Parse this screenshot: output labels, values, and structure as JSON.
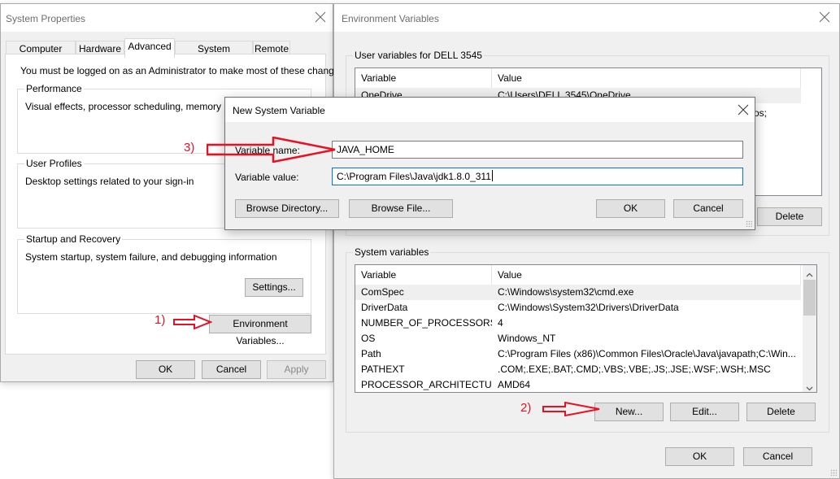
{
  "system_properties": {
    "title": "System Properties",
    "tabs": [
      {
        "label": "Computer Name",
        "active": false
      },
      {
        "label": "Hardware",
        "active": false
      },
      {
        "label": "Advanced",
        "active": true
      },
      {
        "label": "System Protection",
        "active": false
      },
      {
        "label": "Remote",
        "active": false
      }
    ],
    "admin_note": "You must be logged on as an Administrator to make most of these changes.",
    "performance": {
      "legend": "Performance",
      "desc": "Visual effects, processor scheduling, memory usage,"
    },
    "user_profiles": {
      "legend": "User Profiles",
      "desc": "Desktop settings related to your sign-in"
    },
    "startup": {
      "legend": "Startup and Recovery",
      "desc": "System startup, system failure, and debugging information",
      "settings_label": "Settings..."
    },
    "env_vars_label": "Environment Variables...",
    "ok_label": "OK",
    "cancel_label": "Cancel",
    "apply_label": "Apply"
  },
  "environment_variables": {
    "title": "Environment Variables",
    "user_section": {
      "legend": "User variables for DELL 3545",
      "columns": [
        "Variable",
        "Value"
      ],
      "rows": [
        {
          "variable": "OneDrive",
          "value": "C:\\Users\\DELL 3545\\OneDrive"
        }
      ],
      "partial_text": "os;",
      "delete_label": "Delete"
    },
    "system_section": {
      "legend": "System variables",
      "columns": [
        "Variable",
        "Value"
      ],
      "rows": [
        {
          "variable": "ComSpec",
          "value": "C:\\Windows\\system32\\cmd.exe"
        },
        {
          "variable": "DriverData",
          "value": "C:\\Windows\\System32\\Drivers\\DriverData"
        },
        {
          "variable": "NUMBER_OF_PROCESSORS",
          "value": "4"
        },
        {
          "variable": "OS",
          "value": "Windows_NT"
        },
        {
          "variable": "Path",
          "value": "C:\\Program Files (x86)\\Common Files\\Oracle\\Java\\javapath;C:\\Win..."
        },
        {
          "variable": "PATHEXT",
          "value": ".COM;.EXE;.BAT;.CMD;.VBS;.VBE;.JS;.JSE;.WSF;.WSH;.MSC"
        },
        {
          "variable": "PROCESSOR_ARCHITECTURE",
          "value": "AMD64"
        }
      ],
      "new_label": "New...",
      "edit_label": "Edit...",
      "delete_label": "Delete"
    },
    "ok_label": "OK",
    "cancel_label": "Cancel"
  },
  "new_system_variable": {
    "title": "New System Variable",
    "name_label": "Variable name:",
    "name_value": "JAVA_HOME",
    "value_label": "Variable value:",
    "value_value": "C:\\Program Files\\Java\\jdk1.8.0_311",
    "browse_dir_label": "Browse Directory...",
    "browse_file_label": "Browse File...",
    "ok_label": "OK",
    "cancel_label": "Cancel"
  },
  "annotations": {
    "step1": "1)",
    "step2": "2)",
    "step3": "3)",
    "color": "#e81123"
  }
}
